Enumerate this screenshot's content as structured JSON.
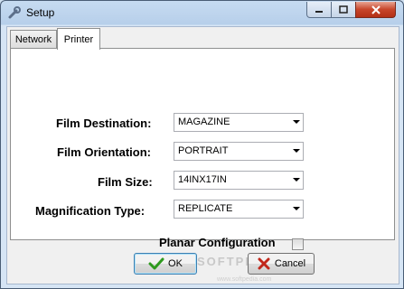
{
  "window": {
    "title": "Setup"
  },
  "tabs": [
    {
      "label": "Network",
      "active": false
    },
    {
      "label": "Printer",
      "active": true
    }
  ],
  "form": {
    "film_destination": {
      "label": "Film Destination:",
      "value": "MAGAZINE"
    },
    "film_orientation": {
      "label": "Film Orientation:",
      "value": "PORTRAIT"
    },
    "film_size": {
      "label": "Film Size:",
      "value": "14INX17IN"
    },
    "magnification_type": {
      "label": "Magnification Type:",
      "value": "REPLICATE"
    },
    "planar_configuration": {
      "label": "Planar Configuration",
      "checked": false
    }
  },
  "buttons": {
    "ok": "OK",
    "cancel": "Cancel"
  },
  "watermark": {
    "main": "SOFTPEDIA",
    "sub": "www.softpedia.com"
  },
  "colors": {
    "ok_check": "#2e9a1e",
    "cancel_x": "#c1271b",
    "close_button": "#c7452a"
  }
}
